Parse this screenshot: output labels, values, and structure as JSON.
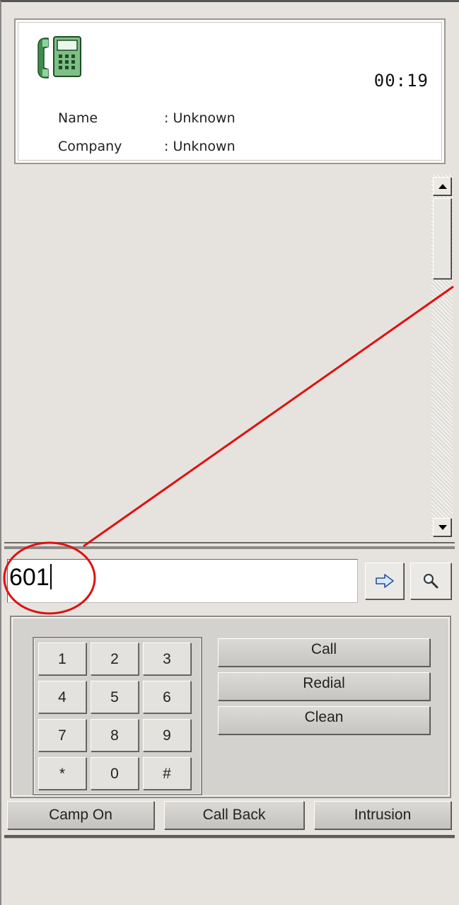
{
  "call_info": {
    "timer": "00:19",
    "name_label": "Name",
    "name_value": ": Unknown",
    "company_label": "Company",
    "company_value": ": Unknown",
    "icon": "desk-phone-icon"
  },
  "dial": {
    "value": "601",
    "go_icon": "arrow-right-icon",
    "search_icon": "magnifier-icon"
  },
  "keypad": {
    "keys": [
      "1",
      "2",
      "3",
      "4",
      "5",
      "6",
      "7",
      "8",
      "9",
      "*",
      "0",
      "#"
    ]
  },
  "actions": {
    "call": "Call",
    "redial": "Redial",
    "clean": "Clean"
  },
  "bottom": {
    "camp_on": "Camp On",
    "call_back": "Call Back",
    "intrusion": "Intrusion"
  },
  "colors": {
    "background": "#e6e3de",
    "annotation_red": "#e01010",
    "phone_green": "#4c9a58"
  }
}
